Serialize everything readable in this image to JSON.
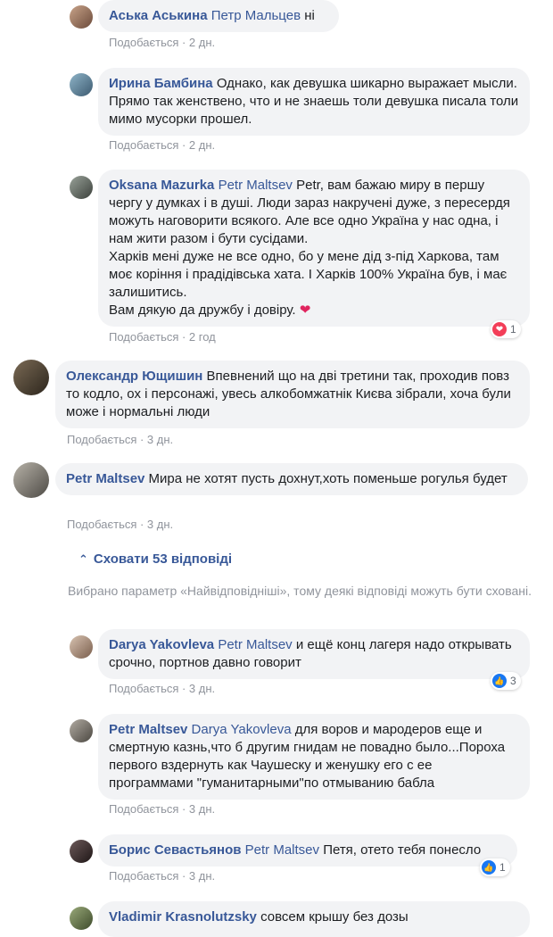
{
  "comments": [
    {
      "author": "Аська Аськина",
      "tag": "Петр Мальцев",
      "text": "ні",
      "meta": "Подобається · 2 дн."
    },
    {
      "author": "Ирина Бамбина",
      "tag": "",
      "text": "Однако, как девушка шикарно выражает мысли. Прямо так женствено, что и не знаешь толи девушка писала толи мимо мусорки прошел.",
      "meta": "Подобається · 2 дн."
    },
    {
      "author": "Oksana Mazurka",
      "tag": "Petr Maltsev",
      "text": "Petr, вам бажаю миру в першу чергу у думках і в душі. Люди зараз накручені дуже, з пересердя можуть наговорити всякого. Але все одно Україна у нас одна, і нам жити разом і бути сусідами.",
      "text2": "Харків мені дуже не все одно, бо у мене дід з-під Харкова, там моє коріння і прадідівська хата. І Харків 100% Україна був, і має залишитись.",
      "text3": "Вам дякую да дружбу і довіру.",
      "meta": "Подобається · 2 год",
      "reaction_count": "1"
    },
    {
      "author": "Олександр Ющишин",
      "tag": "",
      "text": "Впевнений що на дві третини так, проходив повз то кодло, ох і персонажі, увесь алкобомжатнік Києва зібрали, хоча були може і нормальні люди",
      "meta": "Подобається · 3 дн."
    },
    {
      "author": "Petr Maltsev",
      "tag": "",
      "text": "Мира не хотят пусть дохнут,хоть поменьше рогулья будет",
      "meta": "Подобається · 3 дн."
    }
  ],
  "replies_toggle": "Сховати 53 відповіді",
  "notice": "Вибрано параметр «Найвідповідніші», тому деякі відповіді можуть бути сховані.",
  "replies": [
    {
      "author": "Darya Yakovleva",
      "tag": "Petr Maltsev",
      "text": "и ещё конц лагеря надо открывать срочно, портнов давно говорит",
      "meta": "Подобається · 3 дн.",
      "reaction_count": "3"
    },
    {
      "author": "Petr Maltsev",
      "tag": "Darya Yakovleva",
      "text": "для воров и мародеров еще и смертную казнь,что б другим гнидам не повадно было...Пороха первого вздернуть как Чаушеску и женушку его с ее программами \"гуманитарными\"по отмыванию бабла",
      "meta": "Подобається · 3 дн."
    },
    {
      "author": "Борис Севастьянов",
      "tag": "Petr Maltsev",
      "text": "Петя, отето тебя понесло",
      "meta": "Подобається · 3 дн.",
      "reaction_count": "1"
    },
    {
      "author": "Vladimir Krasnolutzsky",
      "tag": "",
      "text": "совсем крышу без дозы"
    }
  ]
}
